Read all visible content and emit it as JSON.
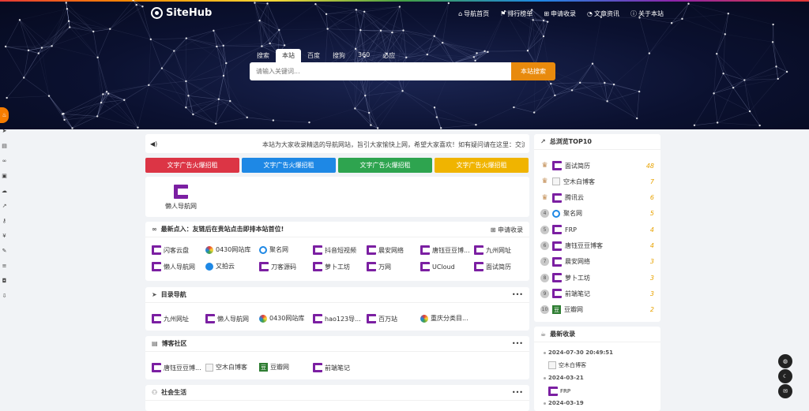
{
  "header": {
    "brand": "SiteHub",
    "nav": [
      {
        "icon": "home-icon",
        "glyph": "⌂",
        "label": "导航首页"
      },
      {
        "icon": "flag-icon",
        "glyph": "⚑",
        "label": "排行榜单"
      },
      {
        "icon": "plus-square-icon",
        "glyph": "⊞",
        "label": "申请收录"
      },
      {
        "icon": "bell-icon",
        "glyph": "◔",
        "label": "文章资讯"
      },
      {
        "icon": "info-icon",
        "glyph": "ⓘ",
        "label": "关于本站"
      }
    ]
  },
  "search": {
    "tabs": [
      "搜索",
      "本站",
      "百度",
      "搜狗",
      "360",
      "必应"
    ],
    "active_tab": "本站",
    "placeholder": "请输入关键词...",
    "button": "本站搜索"
  },
  "notice": {
    "icon": "megaphone-icon",
    "text": "本站为大家收录精选的导航网站，旨引大家愉快上网，希望大家喜欢！如有疑问请在这里：交流反馈"
  },
  "ads": [
    "文字广告火爆招租",
    "文字广告火爆招租",
    "文字广告火爆招租",
    "文字广告火爆招租"
  ],
  "featured": {
    "label": "懒人导航网"
  },
  "latest": {
    "title": "最新点入：友链后在贵站点击即排本站首位!",
    "action": "申请收录",
    "links": [
      {
        "label": "闪客云盘",
        "icon": "logo"
      },
      {
        "label": "0430网站库",
        "icon": "round-color"
      },
      {
        "label": "聚名网",
        "icon": "ring"
      },
      {
        "label": "抖音短视频",
        "icon": "logo"
      },
      {
        "label": "晨安网络",
        "icon": "logo"
      },
      {
        "label": "唐钰豆豆博...",
        "icon": "logo"
      },
      {
        "label": "九州网址",
        "icon": "logo"
      },
      {
        "label": "懒人导航网",
        "icon": "logo"
      },
      {
        "label": "又拍云",
        "icon": "round-blue"
      },
      {
        "label": "刀客源码",
        "icon": "logo"
      },
      {
        "label": "萝卜工坊",
        "icon": "logo"
      },
      {
        "label": "万网",
        "icon": "logo"
      },
      {
        "label": "UCloud",
        "icon": "logo"
      },
      {
        "label": "面试简历",
        "icon": "logo"
      }
    ]
  },
  "catalog": {
    "title": "目录导航",
    "links": [
      {
        "label": "九州网址",
        "icon": "logo"
      },
      {
        "label": "懒人导航网",
        "icon": "logo"
      },
      {
        "label": "0430网站库",
        "icon": "round-color"
      },
      {
        "label": "hao123导...",
        "icon": "logo"
      },
      {
        "label": "百万站",
        "icon": "logo"
      },
      {
        "label": "重庆分类目...",
        "icon": "round-color"
      }
    ]
  },
  "blogs": {
    "title": "博客社区",
    "links": [
      {
        "label": "唐钰豆豆博...",
        "icon": "logo"
      },
      {
        "label": "空木白博客",
        "icon": "broken-image"
      },
      {
        "label": "豆瓣网",
        "icon": "douban"
      },
      {
        "label": "前端笔记",
        "icon": "logo"
      }
    ]
  },
  "social": {
    "title": "社会生活"
  },
  "top10": {
    "title": "总浏览TOP10",
    "rows": [
      {
        "rank": "1",
        "name": "面试简历",
        "count": "48",
        "icon": "logo"
      },
      {
        "rank": "2",
        "name": "空木白博客",
        "count": "7",
        "icon": "broken-image"
      },
      {
        "rank": "3",
        "name": "腾讯云",
        "count": "6",
        "icon": "logo"
      },
      {
        "rank": "4",
        "name": "聚名网",
        "count": "5",
        "icon": "ring"
      },
      {
        "rank": "5",
        "name": "FRP",
        "count": "4",
        "icon": "logo"
      },
      {
        "rank": "6",
        "name": "唐钰豆豆博客",
        "count": "4",
        "icon": "logo"
      },
      {
        "rank": "7",
        "name": "晨安网络",
        "count": "3",
        "icon": "logo"
      },
      {
        "rank": "8",
        "name": "萝卜工坊",
        "count": "3",
        "icon": "logo"
      },
      {
        "rank": "9",
        "name": "前端笔记",
        "count": "3",
        "icon": "logo"
      },
      {
        "rank": "10",
        "name": "豆瓣网",
        "count": "2",
        "icon": "douban"
      }
    ]
  },
  "recent": {
    "title": "最新收录",
    "items": [
      {
        "date": "2024-07-30 20:49:51",
        "name": "空木白博客",
        "icon": "broken-image"
      },
      {
        "date": "2024-03-21",
        "name": "FRP",
        "icon": "logo"
      },
      {
        "date": "2024-03-19",
        "name": "",
        "icon": ""
      }
    ]
  },
  "colors": {
    "accent": "#e88a0d",
    "ad_red": "#dc3545",
    "ad_blue": "#1e88e5",
    "ad_green": "#2ea44f",
    "ad_yellow": "#f0b400",
    "site_logo": "#7b1fa2",
    "rank_count": "#e8a200"
  }
}
